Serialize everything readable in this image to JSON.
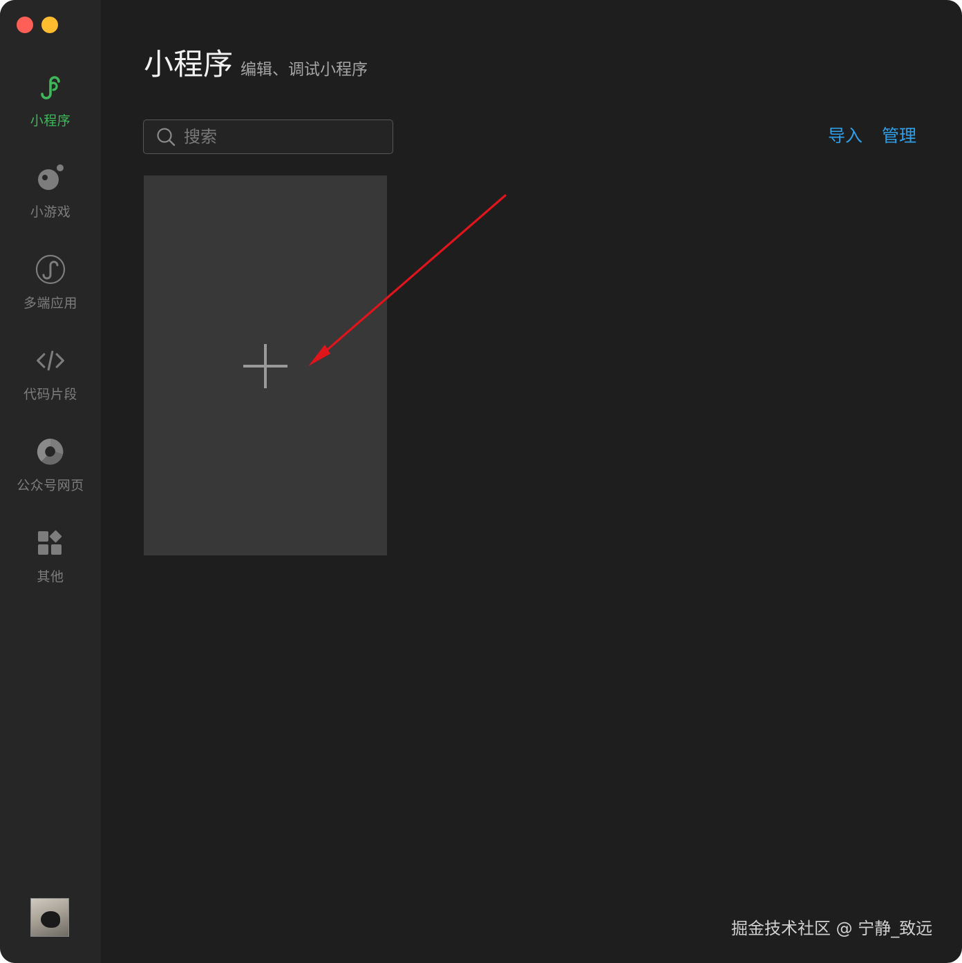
{
  "window": {
    "traffic_lights": [
      "close",
      "minimize"
    ]
  },
  "sidebar": {
    "items": [
      {
        "label": "小程序",
        "icon": "mini-program-icon",
        "active": true
      },
      {
        "label": "小游戏",
        "icon": "mini-game-icon",
        "active": false
      },
      {
        "label": "多端应用",
        "icon": "multi-platform-icon",
        "active": false
      },
      {
        "label": "代码片段",
        "icon": "code-icon",
        "active": false
      },
      {
        "label": "公众号网页",
        "icon": "official-account-icon",
        "active": false
      },
      {
        "label": "其他",
        "icon": "other-grid-icon",
        "active": false
      }
    ],
    "avatar": "user-avatar"
  },
  "header": {
    "title": "小程序",
    "subtitle": "编辑、调试小程序"
  },
  "search": {
    "placeholder": "搜索",
    "value": ""
  },
  "actions": {
    "import_label": "导入",
    "manage_label": "管理"
  },
  "projects": {
    "new_project_icon": "plus-icon"
  },
  "annotation": {
    "arrow_color": "#e0141b"
  },
  "watermark": "掘金技术社区 @ 宁静_致远",
  "colors": {
    "accent_green": "#3fb85a",
    "link_blue": "#2f9ee8",
    "background": "#1e1e1e",
    "sidebar": "#262626",
    "card": "#383838"
  }
}
